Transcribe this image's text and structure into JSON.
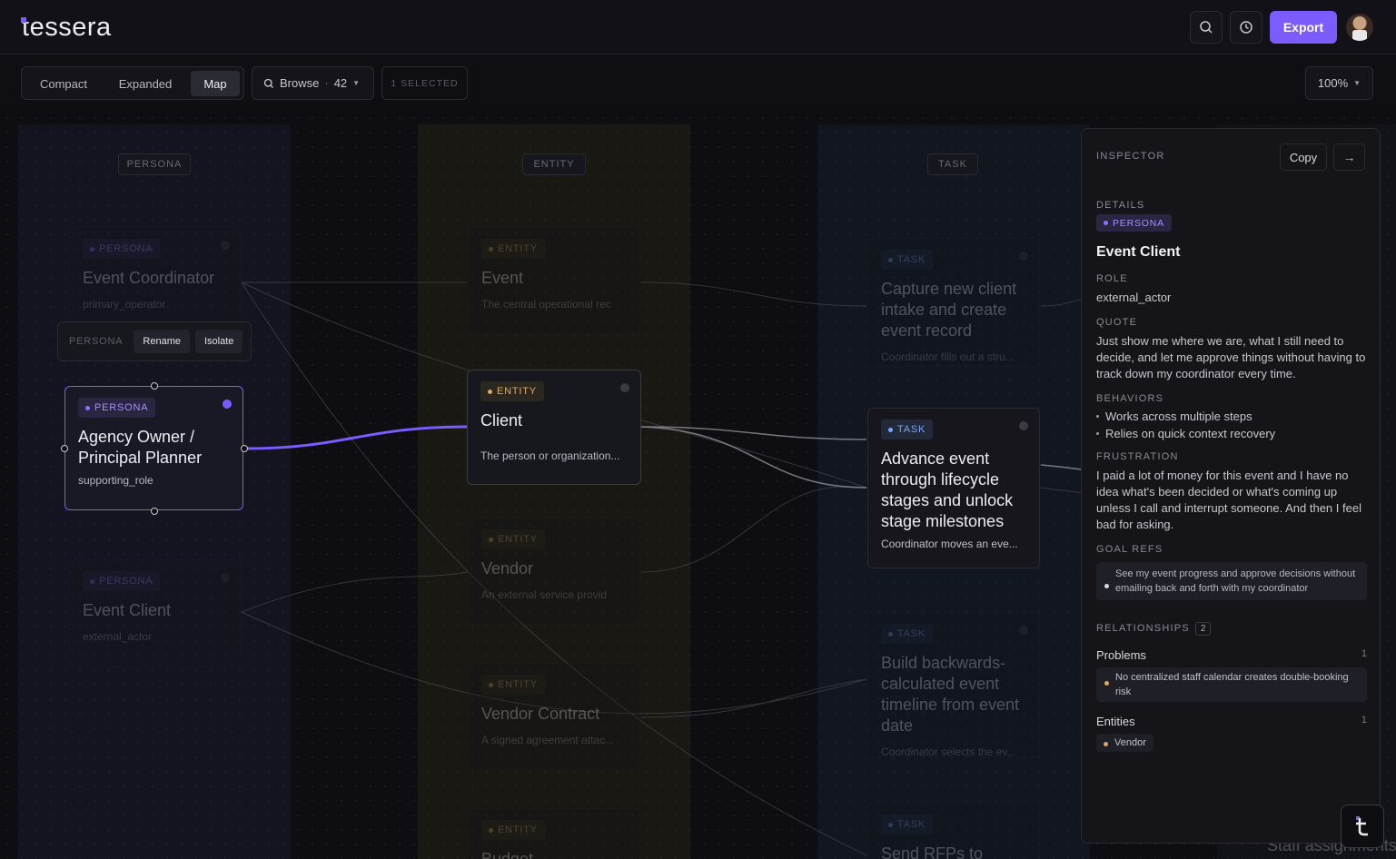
{
  "app": {
    "name": "tessera"
  },
  "topbar": {
    "export_label": "Export",
    "search_icon": "search-icon",
    "history_icon": "history-icon"
  },
  "toolbar": {
    "views": [
      {
        "label": "Compact"
      },
      {
        "label": "Expanded"
      },
      {
        "label": "Map",
        "active": true
      }
    ],
    "browse_label": "Browse",
    "browse_count": "42",
    "selected_label": "1 SELECTED",
    "zoom_label": "100%"
  },
  "lanes": {
    "persona": "PERSONA",
    "entity": "ENTITY",
    "task": "TASK"
  },
  "context_menu": {
    "label": "PERSONA",
    "rename": "Rename",
    "isolate": "Isolate"
  },
  "cards": {
    "p1": {
      "tag": "PERSONA",
      "title": "Event Coordinator",
      "sub": "primary_operator"
    },
    "p2": {
      "tag": "PERSONA",
      "title": "Agency Owner / Principal Planner",
      "sub": "supporting_role"
    },
    "p3": {
      "tag": "PERSONA",
      "title": "Event Client",
      "sub": "external_actor"
    },
    "e1": {
      "tag": "ENTITY",
      "title": "Event",
      "sub": "The central operational rec"
    },
    "e2": {
      "tag": "ENTITY",
      "title": "Client",
      "sub": "The person or organization..."
    },
    "e3": {
      "tag": "ENTITY",
      "title": "Vendor",
      "sub": "An external service provid"
    },
    "e4": {
      "tag": "ENTITY",
      "title": "Vendor Contract",
      "sub": "A signed agreement attac..."
    },
    "e5": {
      "tag": "ENTITY",
      "title": "Budget"
    },
    "t1": {
      "tag": "TASK",
      "title": "Capture new client intake and create event record",
      "sub": "Coordinator fills out a stru..."
    },
    "t2": {
      "tag": "TASK",
      "title": "Advance event through lifecycle stages and unlock stage milestones",
      "sub": "Coordinator moves an eve..."
    },
    "t3": {
      "tag": "TASK",
      "title": "Build backwards-calculated event timeline from event date",
      "sub": "Coordinator selects the ev..."
    },
    "t4": {
      "tag": "TASK",
      "title": "Send RFPs to"
    },
    "x1": {
      "title": "Staff assignments"
    }
  },
  "inspector": {
    "header": "INSPECTOR",
    "copy_label": "Copy",
    "details_label": "DETAILS",
    "tag": "PERSONA",
    "title": "Event Client",
    "role_label": "ROLE",
    "role": "external_actor",
    "quote_label": "QUOTE",
    "quote": "Just show me where we are, what I still need to decide, and let me approve things without having to track down my coordinator every time.",
    "behaviors_label": "BEHAVIORS",
    "behaviors": [
      "Works across multiple steps",
      "Relies on quick context recovery"
    ],
    "frustration_label": "FRUSTRATION",
    "frustration": "I paid a lot of money for this event and I have no idea what's been decided or what's coming up unless I call and interrupt someone. And then I feel bad for asking.",
    "goal_refs_label": "GOAL REFS",
    "goal": "See my event progress and approve decisions without emailing back and forth with my coordinator",
    "relationships_label": "RELATIONSHIPS",
    "relationships_count": "2",
    "problems_label": "Problems",
    "problems_count": "1",
    "problem_item": "No centralized staff calendar creates double-booking risk",
    "entities_label": "Entities",
    "entities_count": "1",
    "entity_item": "Vendor"
  },
  "colors": {
    "accent": "#7c5cff",
    "persona": "#a590ff",
    "entity": "#e0a860",
    "task": "#7da4ff"
  }
}
